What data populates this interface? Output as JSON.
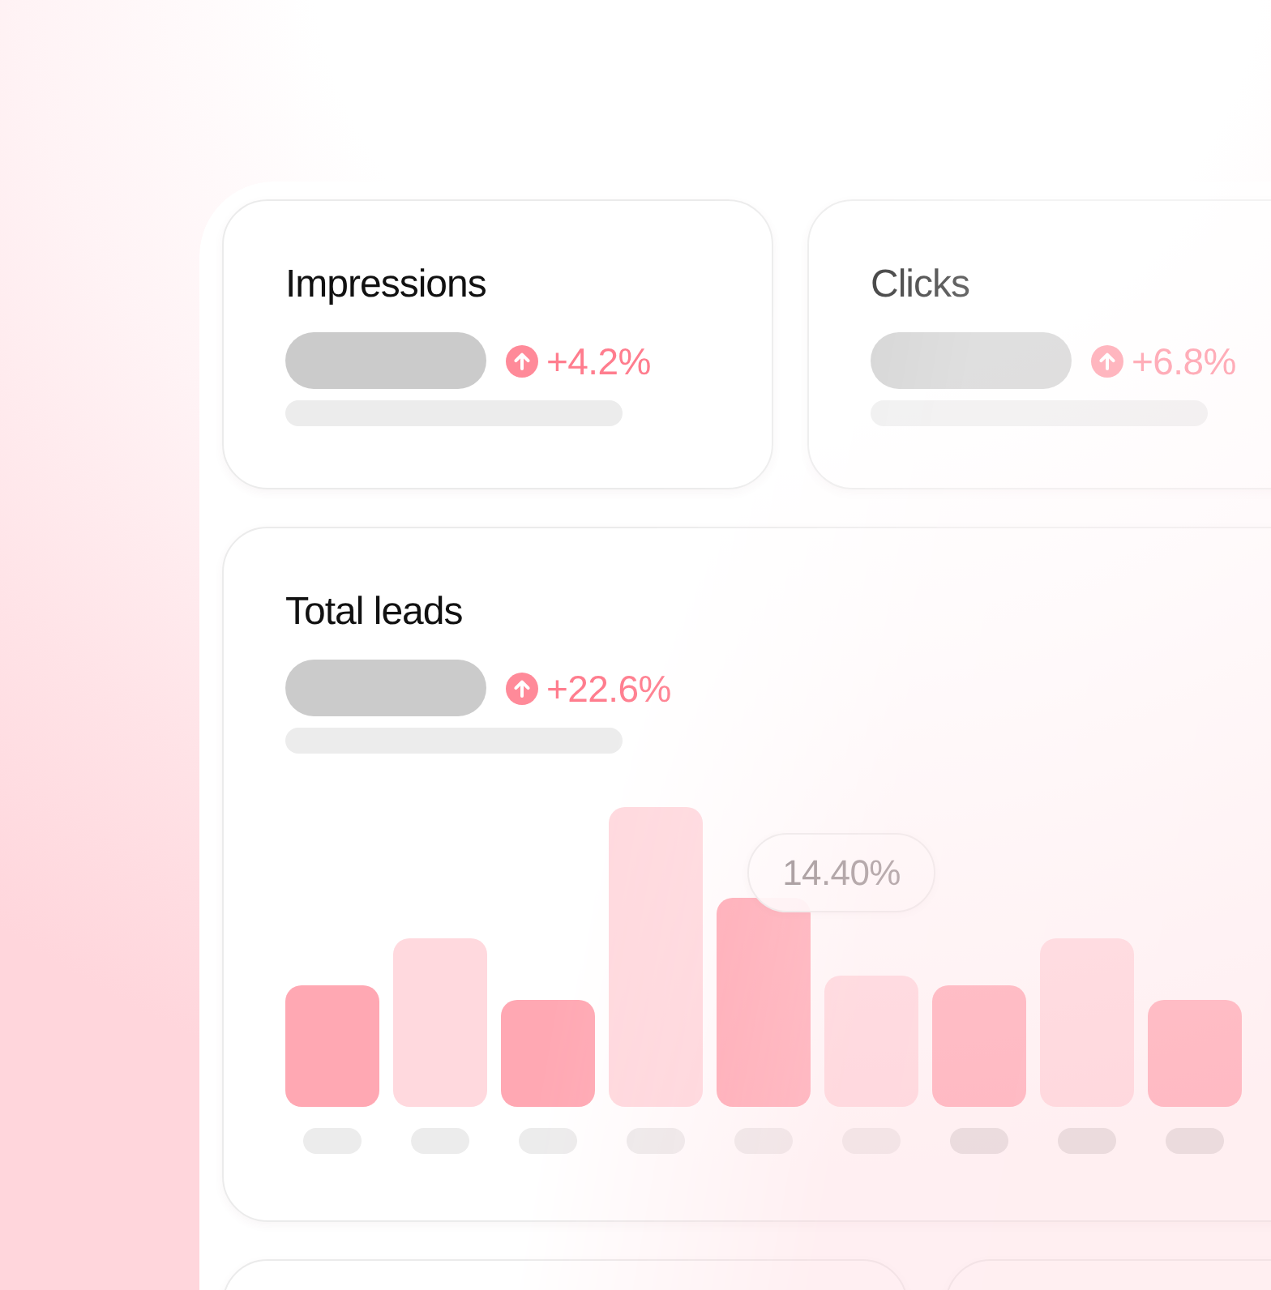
{
  "cards": [
    {
      "title": "Impressions",
      "change": "+4.2%"
    },
    {
      "title": "Clicks",
      "change": "+6.8%"
    }
  ],
  "leads_card": {
    "title": "Total leads",
    "change": "+22.6%",
    "tooltip": "14.40%"
  }
}
